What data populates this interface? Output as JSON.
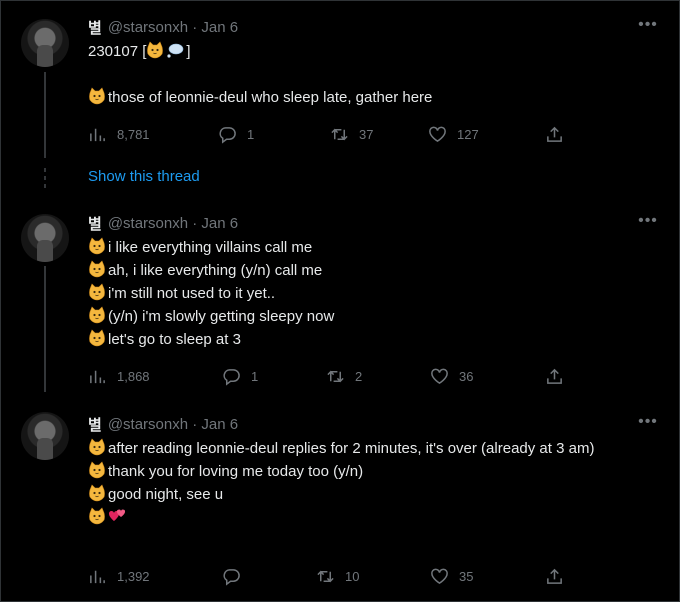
{
  "tweets": [
    {
      "name": "별",
      "meta": "@starsonxh · Jan 6",
      "lines": [
        "230107 [",
        "those of leonnie-deul who sleep late, gather here"
      ],
      "line1_suffix": "]",
      "stats": {
        "views": "8,781",
        "replies": "1",
        "retweets": "37",
        "likes": "127"
      }
    },
    {
      "name": "별",
      "meta": "@starsonxh · Jan 6",
      "lines": [
        "i like everything villains call me",
        "ah, i like everything (y/n) call me",
        "i'm still not used to it yet..",
        "(y/n) i'm slowly getting sleepy now",
        "let's go to sleep at 3"
      ],
      "stats": {
        "views": "1,868",
        "replies": "1",
        "retweets": "2",
        "likes": "36"
      }
    },
    {
      "name": "별",
      "meta": "@starsonxh · Jan 6",
      "lines": [
        "after reading leonnie-deul replies for 2 minutes, it's over (already at 3 am)",
        "thank you for loving me today too (y/n)",
        "good night, see u"
      ],
      "stats": {
        "views": "1,392",
        "replies": "",
        "retweets": "10",
        "likes": "35"
      }
    }
  ],
  "show_thread_label": "Show this thread",
  "icons": [
    "cat-face-emoji",
    "thought-balloon-emoji",
    "two-hearts-emoji",
    "views-icon",
    "reply-icon",
    "retweet-icon",
    "like-icon",
    "share-icon",
    "more-icon"
  ],
  "colors": {
    "background": "#000000",
    "text": "#e7e9ea",
    "muted": "#71767b",
    "link": "#1d9bf0",
    "border": "#2f3336"
  }
}
